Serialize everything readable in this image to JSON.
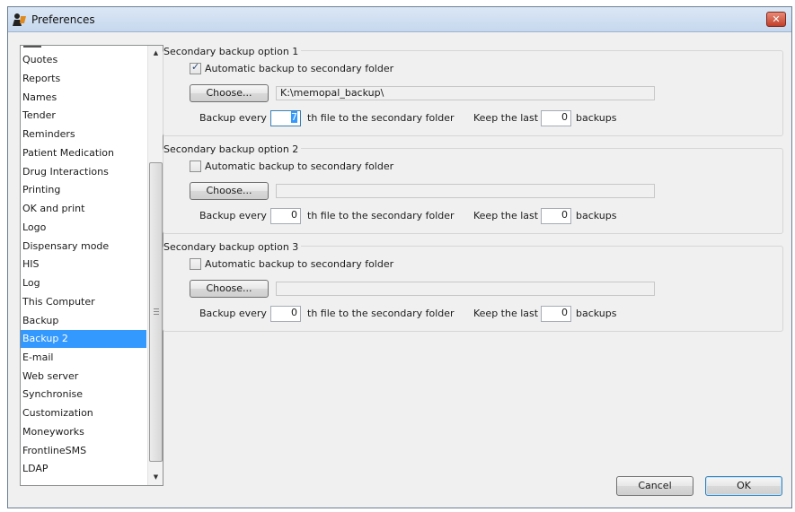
{
  "window": {
    "title": "Preferences",
    "close_glyph": "✕"
  },
  "sidebar": {
    "items": [
      {
        "label": "Quotes"
      },
      {
        "label": "Reports"
      },
      {
        "label": "Names"
      },
      {
        "label": "Tender"
      },
      {
        "label": "Reminders"
      },
      {
        "label": "Patient Medication"
      },
      {
        "label": "Drug Interactions"
      },
      {
        "label": "Printing"
      },
      {
        "label": "OK and print"
      },
      {
        "label": "Logo"
      },
      {
        "label": "Dispensary mode"
      },
      {
        "label": "HIS"
      },
      {
        "label": "Log"
      },
      {
        "label": "This Computer"
      },
      {
        "label": "Backup"
      },
      {
        "label": "Backup 2",
        "selected": true
      },
      {
        "label": "E-mail"
      },
      {
        "label": "Web server"
      },
      {
        "label": "Synchronise"
      },
      {
        "label": "Customization"
      },
      {
        "label": "Moneyworks"
      },
      {
        "label": "FrontlineSMS"
      },
      {
        "label": "LDAP"
      }
    ],
    "scroll_up_glyph": "▲",
    "scroll_down_glyph": "▼"
  },
  "options": [
    {
      "title": "Secondary backup option 1",
      "checkbox_label": "Automatic backup to secondary folder",
      "checked": true,
      "choose_label": "Choose...",
      "path": "K:\\memopal_backup\\",
      "backup_every_label": "Backup every",
      "every_value": "7",
      "th_file_label": "th file to the secondary folder",
      "keep_last_label": "Keep the last",
      "keep_value": "0",
      "backups_label": "backups"
    },
    {
      "title": "Secondary backup option 2",
      "checkbox_label": "Automatic backup to secondary folder",
      "checked": false,
      "choose_label": "Choose...",
      "path": "",
      "backup_every_label": "Backup every",
      "every_value": "0",
      "th_file_label": "th file to the secondary folder",
      "keep_last_label": "Keep the last",
      "keep_value": "0",
      "backups_label": "backups"
    },
    {
      "title": "Secondary backup option 3",
      "checkbox_label": "Automatic backup to secondary folder",
      "checked": false,
      "choose_label": "Choose...",
      "path": "",
      "backup_every_label": "Backup every",
      "every_value": "0",
      "th_file_label": "th file to the secondary folder",
      "keep_last_label": "Keep the last",
      "keep_value": "0",
      "backups_label": "backups"
    }
  ],
  "footer": {
    "cancel_label": "Cancel",
    "ok_label": "OK"
  },
  "colors": {
    "selection": "#3399ff",
    "window_bg": "#f0f0f0"
  }
}
